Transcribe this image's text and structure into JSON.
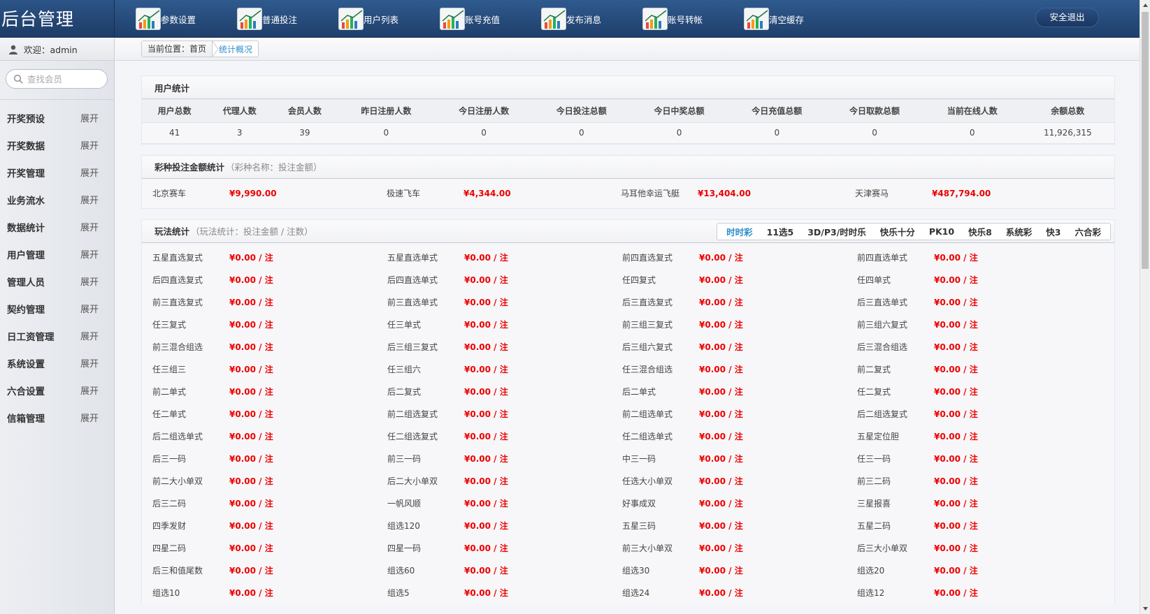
{
  "app": {
    "logo": "后台管理",
    "logout": "安全退出"
  },
  "nav": [
    {
      "label": "参数设置"
    },
    {
      "label": "普通投注"
    },
    {
      "label": "用户列表"
    },
    {
      "label": "账号充值"
    },
    {
      "label": "发布消息"
    },
    {
      "label": "账号转帐"
    },
    {
      "label": "清空缓存"
    }
  ],
  "sidebar": {
    "welcome": "欢迎：admin",
    "search_placeholder": "查找会员",
    "items": [
      {
        "label": "开奖预设",
        "action": "展开"
      },
      {
        "label": "开奖数据",
        "action": "展开"
      },
      {
        "label": "开奖管理",
        "action": "展开"
      },
      {
        "label": "业务流水",
        "action": "展开"
      },
      {
        "label": "数据统计",
        "action": "展开"
      },
      {
        "label": "用户管理",
        "action": "展开"
      },
      {
        "label": "管理人员",
        "action": "展开"
      },
      {
        "label": "契约管理",
        "action": "展开"
      },
      {
        "label": "日工资管理",
        "action": "展开"
      },
      {
        "label": "系统设置",
        "action": "展开"
      },
      {
        "label": "六合设置",
        "action": "展开"
      },
      {
        "label": "信箱管理",
        "action": "展开"
      }
    ]
  },
  "breadcrumb": {
    "prefix": "当前位置：首页",
    "current": "统计概况"
  },
  "user_stats": {
    "title": "用户统计",
    "headers": [
      "用户总数",
      "代理人数",
      "会员人数",
      "昨日注册人数",
      "今日注册人数",
      "今日投注总额",
      "今日中奖总额",
      "今日充值总额",
      "今日取款总额",
      "当前在线人数",
      "余额总数"
    ],
    "values": [
      "41",
      "3",
      "39",
      "0",
      "0",
      "0",
      "0",
      "0",
      "0",
      "0",
      "11,926,315"
    ]
  },
  "lottery_stats": {
    "title": "彩种投注金额统计",
    "subtitle": "（彩种名称：投注金额）",
    "items": [
      {
        "name": "北京赛车",
        "amount": "¥9,990.00"
      },
      {
        "name": "极速飞车",
        "amount": "¥4,344.00"
      },
      {
        "name": "马耳他幸运飞艇",
        "amount": "¥13,404.00"
      },
      {
        "name": "天津赛马",
        "amount": "¥487,794.00"
      }
    ]
  },
  "play_stats": {
    "title": "玩法统计",
    "subtitle": "（玩法统计：投注金额 / 注数）",
    "tabs": [
      "时时彩",
      "11选5",
      "3D/P3/时时乐",
      "快乐十分",
      "PK10",
      "快乐8",
      "系统彩",
      "快3",
      "六合彩"
    ],
    "active_tab": 0,
    "value": "¥0.00 / 注",
    "items": [
      "五星直选复式",
      "五星直选单式",
      "前四直选复式",
      "前四直选单式",
      "后四直选复式",
      "后四直选单式",
      "任四复式",
      "任四单式",
      "前三直选复式",
      "前三直选单式",
      "后三直选复式",
      "后三直选单式",
      "任三复式",
      "任三单式",
      "前三组三复式",
      "前三组六复式",
      "前三混合组选",
      "后三组三复式",
      "后三组六复式",
      "后三混合组选",
      "任三组三",
      "任三组六",
      "任三混合组选",
      "前二复式",
      "前二单式",
      "后二复式",
      "后二单式",
      "任二复式",
      "任二单式",
      "前二组选复式",
      "前二组选单式",
      "后二组选复式",
      "后二组选单式",
      "任二组选复式",
      "任二组选单式",
      "五星定位胆",
      "后三一码",
      "前三一码",
      "中三一码",
      "任三一码",
      "前二大小单双",
      "后二大小单双",
      "任选大小单双",
      "前三二码",
      "后三二码",
      "一帆风顺",
      "好事成双",
      "三星报喜",
      "四季发财",
      "组选120",
      "五星三码",
      "五星二码",
      "四星二码",
      "四星一码",
      "前三大小单双",
      "后三大小单双",
      "后三和值尾数",
      "组选60",
      "组选30",
      "组选20",
      "组选10",
      "组选5",
      "组选24",
      "组选12"
    ]
  }
}
